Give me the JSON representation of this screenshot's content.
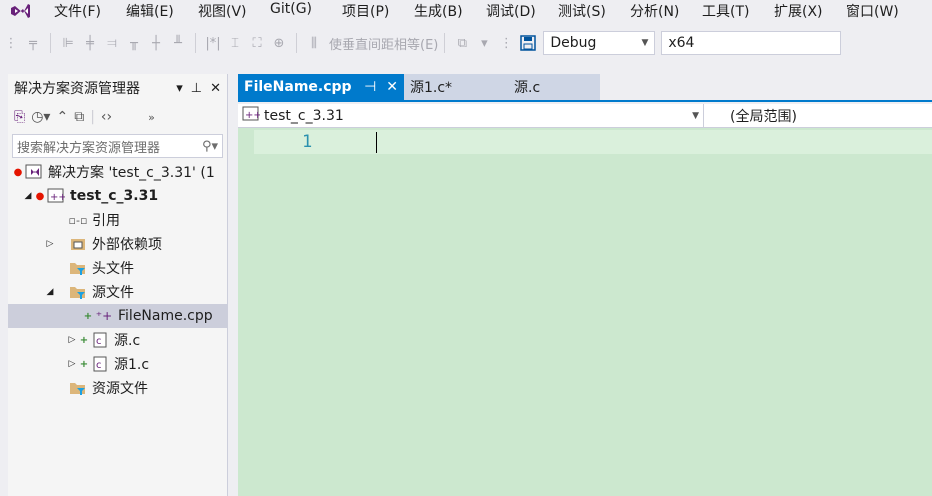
{
  "menu": {
    "items": [
      "文件(F)",
      "编辑(E)",
      "视图(V)",
      "Git(G)",
      "项目(P)",
      "生成(B)",
      "调试(D)",
      "测试(S)",
      "分析(N)",
      "工具(T)",
      "扩展(X)",
      "窗口(W)"
    ]
  },
  "toolbar": {
    "align_text": "使垂直间距相等(E)",
    "configuration": "Debug",
    "platform": "x64"
  },
  "solution_explorer": {
    "title": "解决方案资源管理器",
    "search_placeholder": "搜索解决方案资源管理器",
    "solution_label": "解决方案 'test_c_3.31' (1",
    "project_label": "test_c_3.31",
    "references": "引用",
    "external_deps": "外部依赖项",
    "header_files": "头文件",
    "source_files": "源文件",
    "file_cpp": "FileName.cpp",
    "file_yuan": "源.c",
    "file_yuan1": "源1.c",
    "resource_files": "资源文件"
  },
  "editor": {
    "tabs": [
      {
        "label": "FileName.cpp",
        "active": true
      },
      {
        "label": "源1.c*",
        "active": false
      },
      {
        "label": "源.c",
        "active": false
      }
    ],
    "nav_project": "test_c_3.31",
    "nav_scope": "(全局范围)",
    "line_number": "1"
  },
  "colors": {
    "accent": "#007acc",
    "editor_bg": "#cce8cf",
    "line_number": "#2b91af"
  }
}
